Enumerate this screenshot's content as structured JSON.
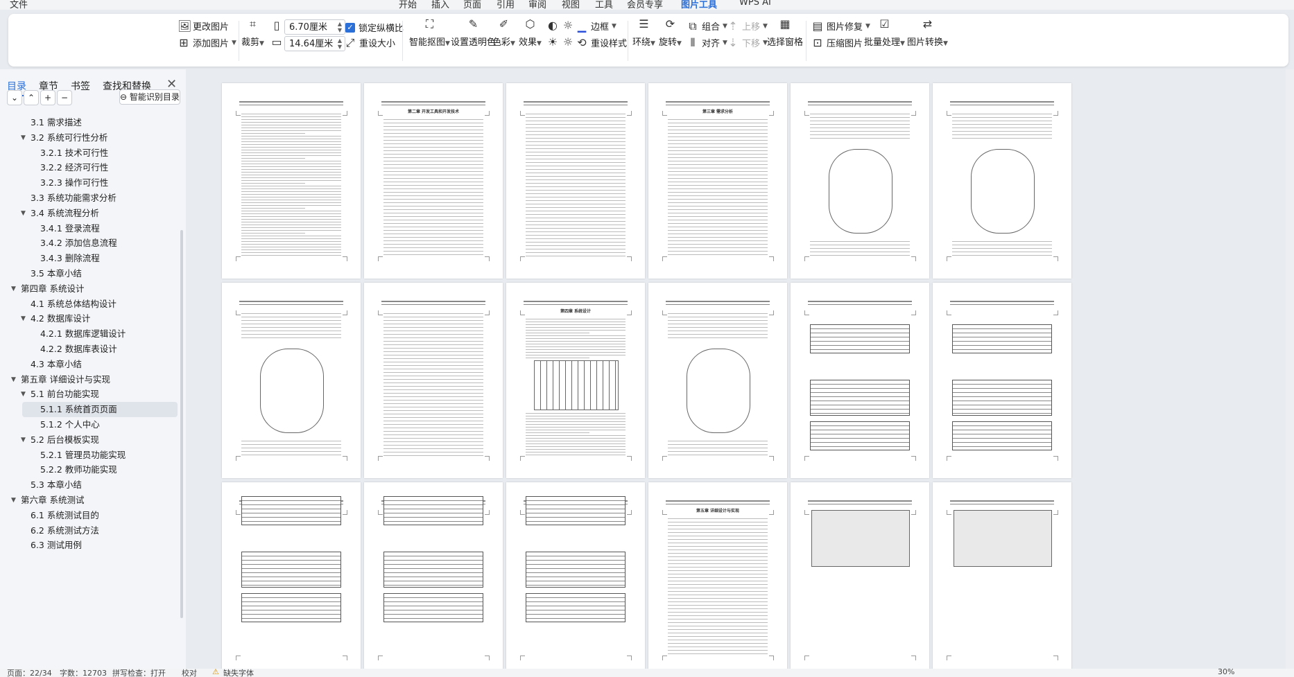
{
  "menu": {
    "items": [
      "文件",
      "开始",
      "插入",
      "页面",
      "引用",
      "审阅",
      "视图",
      "工具",
      "会员专享",
      "图片工具",
      "WPS AI"
    ],
    "active": "图片工具"
  },
  "ribbon": {
    "change_picture": "更改图片",
    "add_picture": "添加图片",
    "crop": "裁剪",
    "width_value": "6.70厘米",
    "height_value": "14.64厘米",
    "lock_ratio": "锁定纵横比",
    "reset_size": "重设大小",
    "smart_matting": "智能抠图",
    "set_transparent": "设置透明色",
    "color": "色彩",
    "effects": "效果",
    "border": "边框",
    "reset_style": "重设样式",
    "wrap": "环绕",
    "rotate": "旋转",
    "group": "组合",
    "align": "对齐",
    "move_up": "上移",
    "move_down": "下移",
    "selection_pane": "选择窗格",
    "picture_repair": "图片修复",
    "compress": "压缩图片",
    "batch": "批量处理",
    "convert": "图片转换"
  },
  "sidebar": {
    "tabs": [
      "目录",
      "章节",
      "书签",
      "查找和替换"
    ],
    "smart_toc": "智能识别目录",
    "toc": [
      {
        "label": "3.1  需求描述",
        "level": 1,
        "arrow": false
      },
      {
        "label": "3.2  系统可行性分析",
        "level": 1,
        "arrow": true
      },
      {
        "label": "3.2.1 技术可行性",
        "level": 2,
        "arrow": false
      },
      {
        "label": "3.2.2  经济可行性",
        "level": 2,
        "arrow": false
      },
      {
        "label": "3.2.3  操作可行性",
        "level": 2,
        "arrow": false
      },
      {
        "label": "3.3  系统功能需求分析",
        "level": 1,
        "arrow": false
      },
      {
        "label": "3.4  系统流程分析",
        "level": 1,
        "arrow": true
      },
      {
        "label": "3.4.1  登录流程",
        "level": 2,
        "arrow": false
      },
      {
        "label": "3.4.2  添加信息流程",
        "level": 2,
        "arrow": false
      },
      {
        "label": "3.4.3  删除流程",
        "level": 2,
        "arrow": false
      },
      {
        "label": "3.5  本章小结",
        "level": 1,
        "arrow": false
      },
      {
        "label": "第四章  系统设计",
        "level": 0,
        "arrow": true
      },
      {
        "label": "4.1  系统总体结构设计",
        "level": 1,
        "arrow": false
      },
      {
        "label": "4.2  数据库设计",
        "level": 1,
        "arrow": true
      },
      {
        "label": "4.2.1  数据库逻辑设计",
        "level": 2,
        "arrow": false
      },
      {
        "label": "4.2.2  数据库表设计",
        "level": 2,
        "arrow": false
      },
      {
        "label": "4.3  本章小结",
        "level": 1,
        "arrow": false
      },
      {
        "label": "第五章  详细设计与实现",
        "level": 0,
        "arrow": true
      },
      {
        "label": "5.1  前台功能实现",
        "level": 1,
        "arrow": true
      },
      {
        "label": "5.1.1 系统首页页面",
        "level": 2,
        "arrow": false,
        "selected": true
      },
      {
        "label": "5.1.2 个人中心",
        "level": 2,
        "arrow": false
      },
      {
        "label": "5.2  后台模板实现",
        "level": 1,
        "arrow": true
      },
      {
        "label": "5.2.1  管理员功能实现",
        "level": 2,
        "arrow": false
      },
      {
        "label": "5.2.2  教师功能实现",
        "level": 2,
        "arrow": false
      },
      {
        "label": "5.3  本章小结",
        "level": 1,
        "arrow": false
      },
      {
        "label": "第六章  系统测试",
        "level": 0,
        "arrow": true
      },
      {
        "label": "6.1  系统测试目的",
        "level": 1,
        "arrow": false
      },
      {
        "label": "6.2  系统测试方法",
        "level": 1,
        "arrow": false
      },
      {
        "label": "6.3  测试用例",
        "level": 1,
        "arrow": false
      }
    ]
  },
  "pages": {
    "row1": [
      {
        "title": ""
      },
      {
        "title": "第二章  开发工具和开发技术"
      },
      {
        "title": ""
      },
      {
        "title": "第三章  需求分析"
      },
      {
        "title": ""
      },
      {
        "title": ""
      }
    ],
    "row2": [
      {
        "title": ""
      },
      {
        "title": ""
      },
      {
        "title": "第四章  系统设计"
      },
      {
        "title": ""
      },
      {
        "title": ""
      },
      {
        "title": ""
      }
    ],
    "row3": [
      {
        "title": ""
      },
      {
        "title": ""
      },
      {
        "title": ""
      },
      {
        "title": "第五章  详细设计与实现"
      },
      {
        "title": ""
      },
      {
        "title": ""
      }
    ]
  },
  "status": {
    "page": "页面：22/34",
    "words": "字数：12703",
    "spell": "拼写检查：打开",
    "proof": "校对",
    "font_missing": "缺失字体",
    "zoom": "30%"
  }
}
